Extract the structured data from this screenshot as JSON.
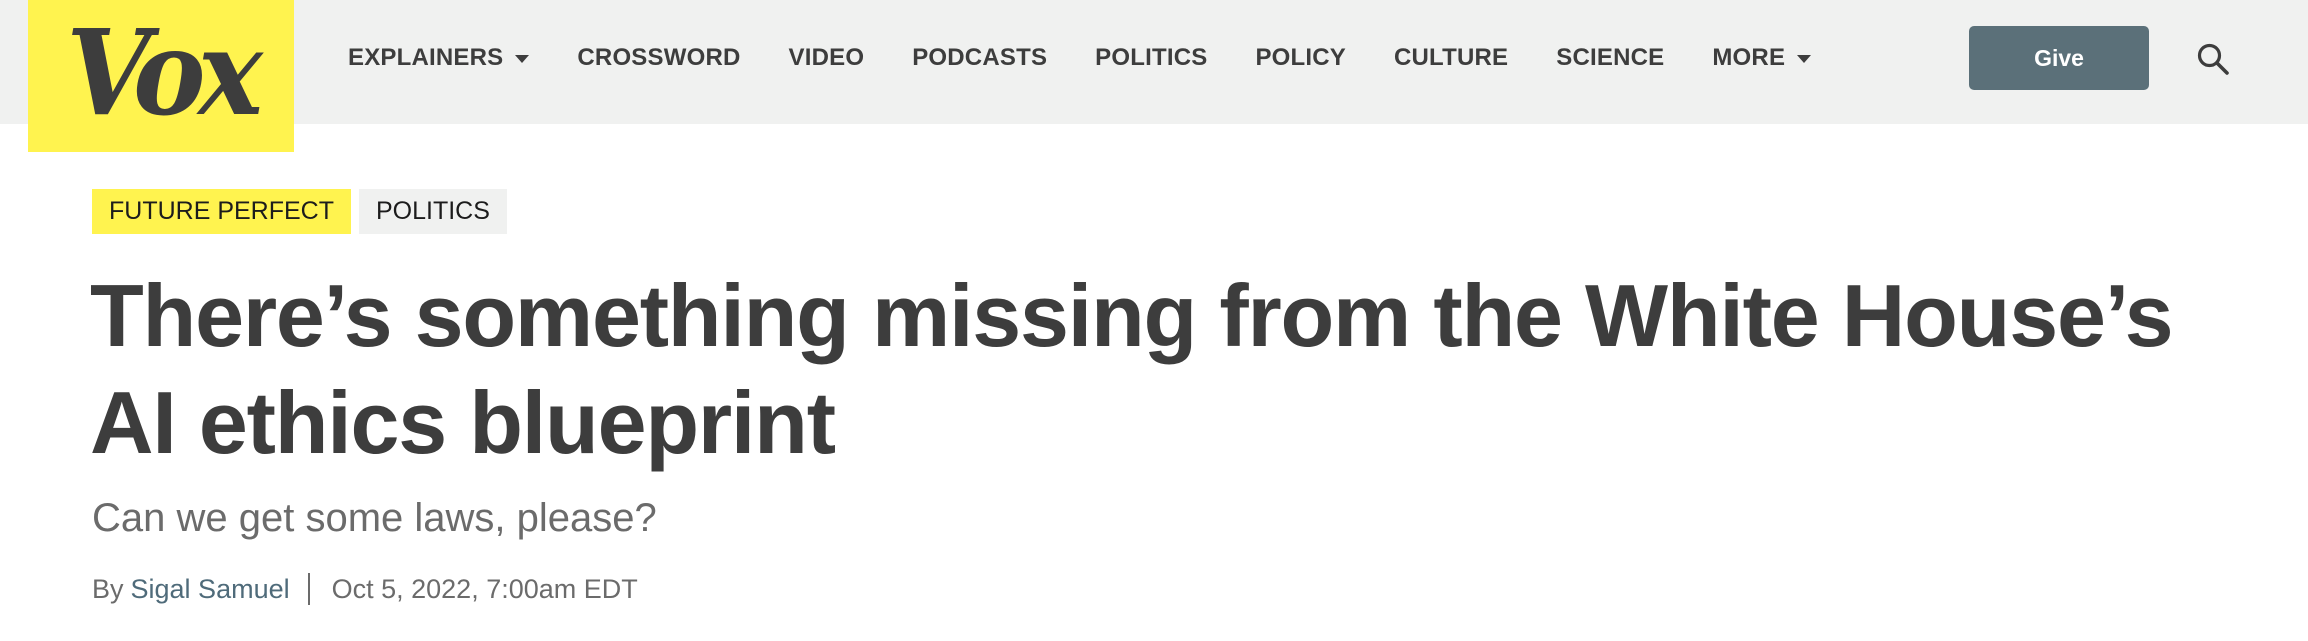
{
  "header": {
    "logo_text": "Vox",
    "nav": [
      {
        "label": "EXPLAINERS",
        "has_dropdown": true
      },
      {
        "label": "CROSSWORD",
        "has_dropdown": false
      },
      {
        "label": "VIDEO",
        "has_dropdown": false
      },
      {
        "label": "PODCASTS",
        "has_dropdown": false
      },
      {
        "label": "POLITICS",
        "has_dropdown": false
      },
      {
        "label": "POLICY",
        "has_dropdown": false
      },
      {
        "label": "CULTURE",
        "has_dropdown": false
      },
      {
        "label": "SCIENCE",
        "has_dropdown": false
      },
      {
        "label": "MORE",
        "has_dropdown": true
      }
    ],
    "give_label": "Give",
    "search_icon": "search-icon"
  },
  "article": {
    "tags": [
      {
        "label": "FUTURE PERFECT",
        "style": "primary"
      },
      {
        "label": "POLITICS",
        "style": "secondary"
      }
    ],
    "headline": "There’s something missing from the White House’s AI ethics blueprint",
    "dek": "Can we get some laws, please?",
    "byline": {
      "prefix": "By",
      "author": "Sigal Samuel",
      "date": "Oct 5, 2022, 7:00am EDT"
    }
  },
  "colors": {
    "brand_yellow": "#fff34f",
    "header_bg": "#f0f1f0",
    "give_button": "#5b7079",
    "text_dark": "#3d3d3d",
    "text_muted": "#6b6b6b",
    "author_link": "#4f6b7a"
  }
}
